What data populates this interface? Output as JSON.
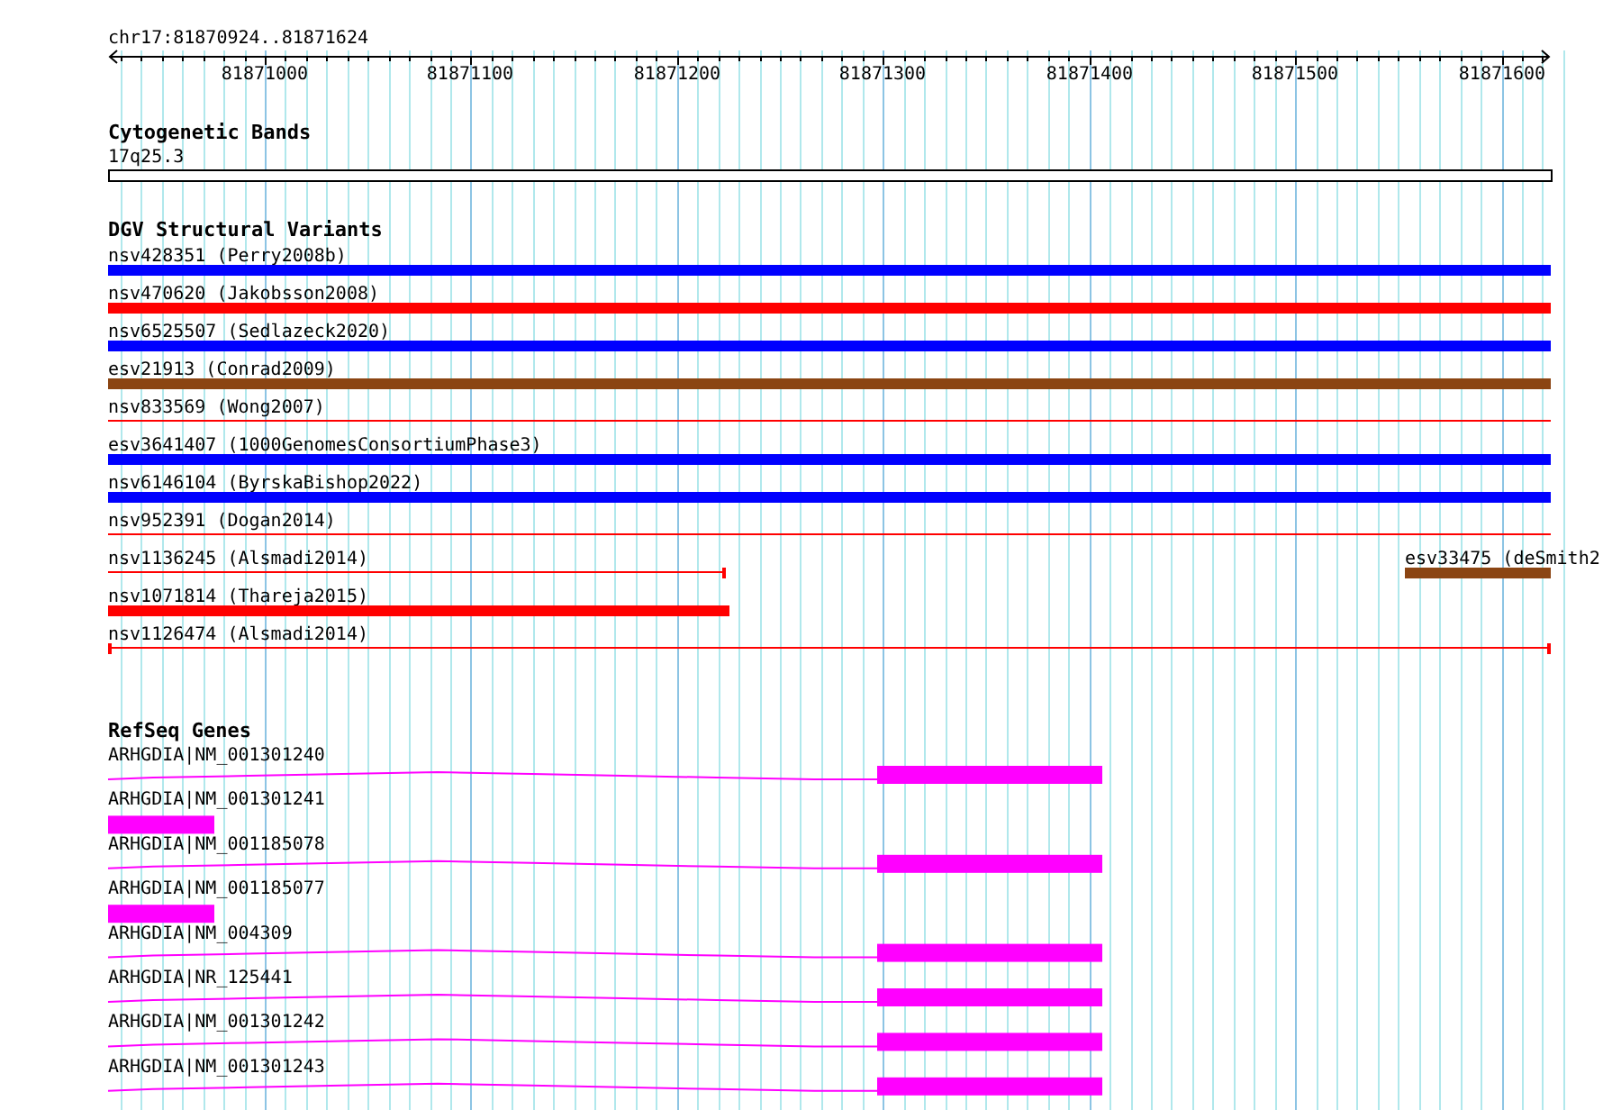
{
  "ruler": {
    "region": "chr17:81870924..81871624",
    "ticks": [
      "81871000",
      "81871100",
      "81871200",
      "81871300",
      "81871400",
      "81871500",
      "81871600"
    ]
  },
  "tracks": [
    {
      "title": "Cytogenetic Bands",
      "kind": "bands",
      "features": [
        {
          "label": "17q25.3"
        }
      ]
    },
    {
      "title": "DGV Structural Variants",
      "kind": "variants",
      "features": [
        {
          "label": "nsv428351 (Perry2008b)",
          "kind": "bar",
          "color": "#0000ff"
        },
        {
          "label": "nsv470620 (Jakobsson2008)",
          "kind": "bar",
          "color": "#ff0000"
        },
        {
          "label": "nsv6525507 (Sedlazeck2020)",
          "kind": "bar",
          "color": "#0000ff"
        },
        {
          "label": "esv21913 (Conrad2009)",
          "kind": "bar",
          "color": "#8b4513"
        },
        {
          "label": "nsv833569 (Wong2007)",
          "kind": "line",
          "color": "#ff0000"
        },
        {
          "label": "esv3641407 (1000GenomesConsortiumPhase3)",
          "kind": "bar",
          "color": "#0000ff"
        },
        {
          "label": "nsv6146104 (ByrskaBishop2022)",
          "kind": "bar",
          "color": "#0000ff"
        },
        {
          "label": "nsv952391 (Dogan2014)",
          "kind": "line",
          "color": "#ff0000"
        },
        {
          "label": "nsv1136245 (Alsmadi2014)",
          "kind": "line",
          "color": "#ff0000"
        },
        {
          "label": "esv33475 (deSmith2",
          "kind": "bar",
          "color": "#8b4513"
        },
        {
          "label": "nsv1071814 (Thareja2015)",
          "kind": "bar",
          "color": "#ff0000"
        },
        {
          "label": "nsv1126474 (Alsmadi2014)",
          "kind": "line",
          "color": "#ff0000"
        }
      ]
    },
    {
      "title": "RefSeq Genes",
      "kind": "genes",
      "features": [
        {
          "label": "ARHGDIA|NM_001301240",
          "kind": "transcript"
        },
        {
          "label": "ARHGDIA|NM_001301241",
          "kind": "exon"
        },
        {
          "label": "ARHGDIA|NM_001185078",
          "kind": "transcript"
        },
        {
          "label": "ARHGDIA|NM_001185077",
          "kind": "exon"
        },
        {
          "label": "ARHGDIA|NM_004309",
          "kind": "transcript"
        },
        {
          "label": "ARHGDIA|NR_125441",
          "kind": "transcript"
        },
        {
          "label": "ARHGDIA|NM_001301242",
          "kind": "transcript"
        },
        {
          "label": "ARHGDIA|NM_001301243",
          "kind": "transcript"
        }
      ]
    }
  ]
}
